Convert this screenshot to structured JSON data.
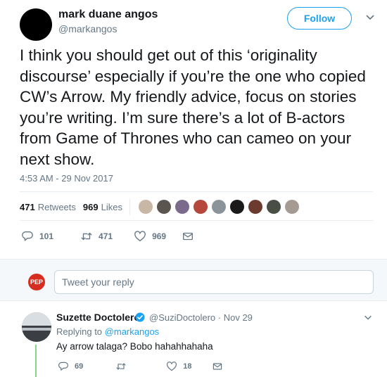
{
  "author": {
    "name": "mark duane angos",
    "handle": "@markangos"
  },
  "follow_label": "Follow",
  "tweet": {
    "text": "I think you should get out of this ‘originality discourse’ especially if you’re the one who copied CW’s Arrow. My friendly advice, focus on stories you’re writing. I’m sure there’s a lot of B-actors from Game of Thrones who can cameo on your next show.",
    "timestamp": "4:53 AM - 29 Nov 2017"
  },
  "stats": {
    "retweets_count": "471",
    "retweets_label": "Retweets",
    "likes_count": "969",
    "likes_label": "Likes"
  },
  "liker_colors": [
    "#c9b7a6",
    "#5b5550",
    "#7a6a8c",
    "#b5473d",
    "#8b949b",
    "#1a1a1a",
    "#6b3b2f",
    "#4a4f45",
    "#a59b93"
  ],
  "actions": {
    "replies": "101",
    "retweets": "471",
    "likes": "969"
  },
  "reply_box": {
    "avatar_text": "PEP",
    "placeholder": "Tweet your reply"
  },
  "reply": {
    "name": "Suzette Doctolero",
    "handle": "@SuziDoctolero",
    "separator": "·",
    "date": "Nov 29",
    "replying_label": "Replying to",
    "replying_handle": "@markangos",
    "text": "Ay arrow talaga? Bobo hahahhahaha",
    "replies": "69",
    "likes": "18"
  },
  "colors": {
    "accent": "#1da1f2",
    "muted": "#657786",
    "text": "#14171a",
    "thread": "#84d68a"
  }
}
